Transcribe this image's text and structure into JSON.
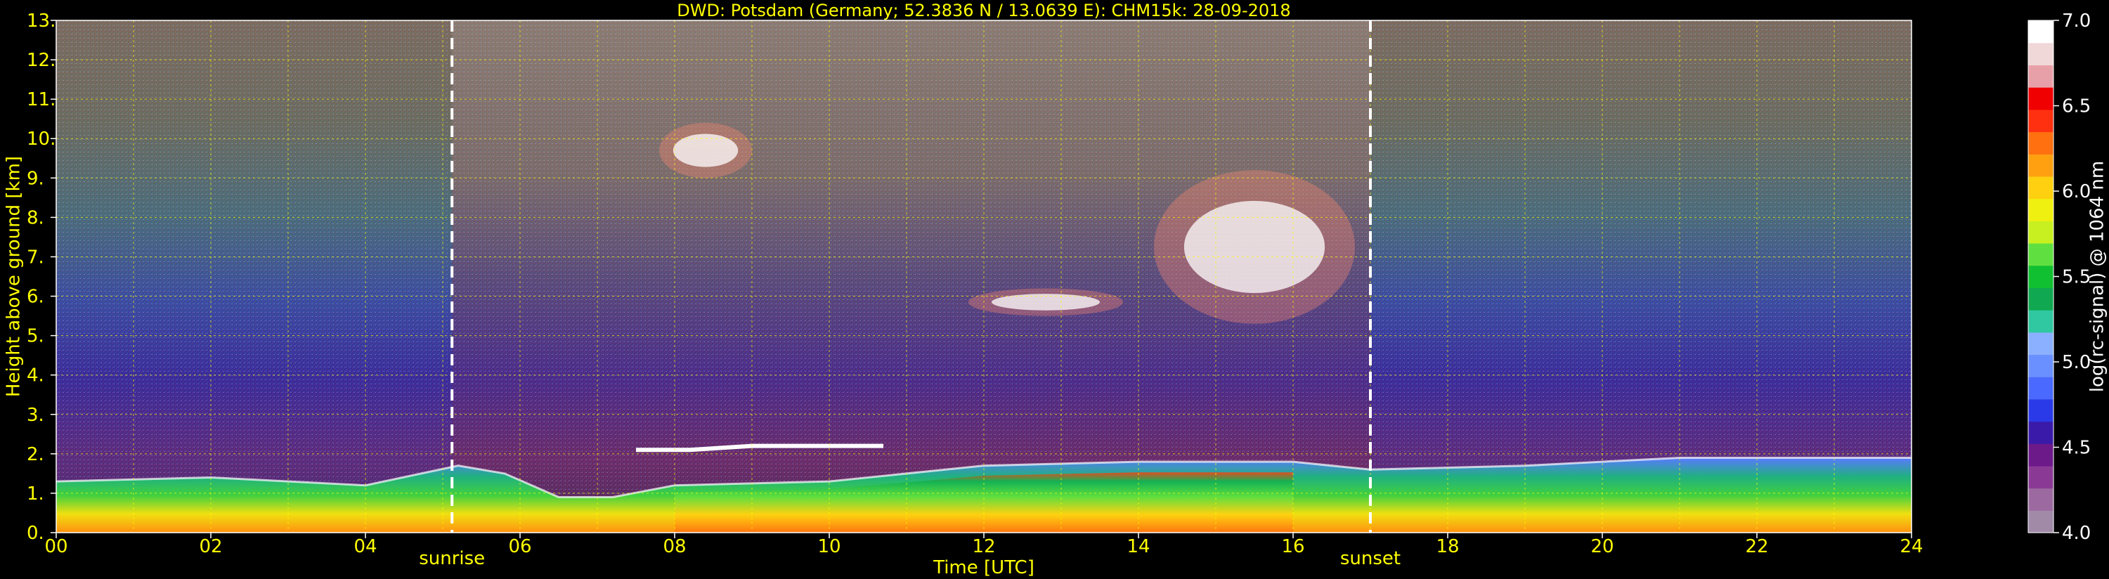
{
  "chart_data": {
    "type": "heatmap",
    "title": "DWD: Potsdam (Germany; 52.3836 N / 13.0639 E):    CHM15k: 28-09-2018",
    "xlabel": "Time [UTC]",
    "ylabel": "Height above ground [km]",
    "xlim": [
      0,
      24
    ],
    "ylim": [
      0,
      13
    ],
    "x_ticks": [
      "00",
      "02",
      "04",
      "06",
      "08",
      "10",
      "12",
      "14",
      "16",
      "18",
      "20",
      "22",
      "24"
    ],
    "y_ticks": [
      "0.",
      "1.",
      "2.",
      "3.",
      "4.",
      "5.",
      "6.",
      "7.",
      "8.",
      "9.",
      "10.",
      "11.",
      "12.",
      "13."
    ],
    "grid": true,
    "grid_x_step": 1,
    "grid_y_step": 1,
    "events": [
      {
        "label": "sunrise",
        "time": 5.12
      },
      {
        "label": "sunset",
        "time": 17.0
      }
    ],
    "colorbar": {
      "label": "log(rc-signal) @ 1064 nm",
      "range": [
        4.0,
        7.0
      ],
      "ticks": [
        "4.0",
        "4.5",
        "5.0",
        "5.5",
        "6.0",
        "6.5",
        "7.0"
      ],
      "colors": [
        "#a08aa8",
        "#9c6aa0",
        "#8a3a94",
        "#6c1a8a",
        "#3a1aa8",
        "#2a3ae8",
        "#4a6aff",
        "#6a90ff",
        "#8ab0ff",
        "#30c8a0",
        "#10a850",
        "#10c030",
        "#60e040",
        "#c8f020",
        "#f0f010",
        "#ffd010",
        "#ffa010",
        "#ff7010",
        "#ff3010",
        "#f00000",
        "#e8a0a8",
        "#f0d8d8",
        "#ffffff"
      ]
    },
    "features": {
      "boundary_layer_top_km": [
        [
          0,
          1.3
        ],
        [
          2,
          1.4
        ],
        [
          4,
          1.2
        ],
        [
          5.2,
          1.7
        ],
        [
          5.8,
          1.5
        ],
        [
          6.5,
          0.9
        ],
        [
          7.2,
          0.9
        ],
        [
          8,
          1.2
        ],
        [
          10,
          1.3
        ],
        [
          12,
          1.7
        ],
        [
          14,
          1.8
        ],
        [
          16,
          1.8
        ],
        [
          17,
          1.6
        ],
        [
          19,
          1.7
        ],
        [
          21,
          1.9
        ],
        [
          22,
          1.9
        ],
        [
          24,
          1.9
        ]
      ],
      "residual_layer_km": [
        [
          7.5,
          2.1
        ],
        [
          8.2,
          2.1
        ],
        [
          9,
          2.2
        ],
        [
          10.7,
          2.2
        ]
      ],
      "cirrus_clouds": [
        {
          "t0": 14.2,
          "t1": 16.8,
          "bottom_km": 5.3,
          "top_km": 9.2
        },
        {
          "t0": 11.8,
          "t1": 13.8,
          "bottom_km": 5.5,
          "top_km": 6.2
        },
        {
          "t0": 7.8,
          "t1": 9.0,
          "bottom_km": 9.0,
          "top_km": 10.4
        }
      ]
    }
  }
}
